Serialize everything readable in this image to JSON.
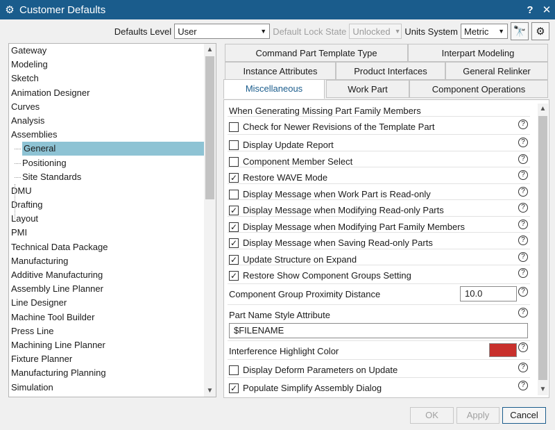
{
  "window": {
    "title": "Customer Defaults",
    "help_label": "?",
    "close_label": "✕",
    "gear_glyph": "⚙"
  },
  "toolbar": {
    "defaults_level_label": "Defaults Level",
    "defaults_level_value": "User",
    "lock_state_label": "Default Lock State",
    "lock_state_value": "Unlocked",
    "units_label": "Units System",
    "units_value": "Metric",
    "find_icon_glyph": "🔭",
    "settings_icon_glyph": "⚙"
  },
  "tree": {
    "items": [
      {
        "label": "Gateway"
      },
      {
        "label": "Modeling"
      },
      {
        "label": "Sketch"
      },
      {
        "label": "Animation Designer"
      },
      {
        "label": "Curves"
      },
      {
        "label": "Analysis"
      },
      {
        "label": "Assemblies"
      },
      {
        "label": "General"
      },
      {
        "label": "Positioning"
      },
      {
        "label": "Site Standards"
      },
      {
        "label": "DMU"
      },
      {
        "label": "Drafting"
      },
      {
        "label": "Layout"
      },
      {
        "label": "PMI"
      },
      {
        "label": "Technical Data Package"
      },
      {
        "label": "Manufacturing"
      },
      {
        "label": "Additive Manufacturing"
      },
      {
        "label": "Assembly Line Planner"
      },
      {
        "label": "Line Designer"
      },
      {
        "label": "Machine Tool Builder"
      },
      {
        "label": "Press Line"
      },
      {
        "label": "Machining Line Planner"
      },
      {
        "label": "Fixture Planner"
      },
      {
        "label": "Manufacturing Planning"
      },
      {
        "label": "Simulation"
      }
    ],
    "selected": "General"
  },
  "tabs": {
    "row1": [
      "Command Part Template Type",
      "Interpart Modeling"
    ],
    "row2": [
      "Instance Attributes",
      "Product Interfaces",
      "General Relinker"
    ],
    "row3": [
      "Miscellaneous",
      "Work Part",
      "Component Operations"
    ],
    "active": "Miscellaneous"
  },
  "panel": {
    "section_heading": "When Generating Missing Part Family Members",
    "options": [
      {
        "label": "Check for Newer Revisions of the Template Part",
        "checked": false
      },
      {
        "label": "Display Update Report",
        "checked": false
      },
      {
        "label": "Component Member Select",
        "checked": false
      },
      {
        "label": "Restore WAVE Mode",
        "checked": true
      },
      {
        "label": "Display Message when Work Part is Read-only",
        "checked": false
      },
      {
        "label": "Display Message when Modifying Read-only Parts",
        "checked": true
      },
      {
        "label": "Display Message when Modifying Part Family Members",
        "checked": true
      },
      {
        "label": "Display Message when Saving Read-only Parts",
        "checked": true
      },
      {
        "label": "Update Structure on Expand",
        "checked": true
      },
      {
        "label": "Restore Show Component Groups Setting",
        "checked": true
      }
    ],
    "proximity_label": "Component Group Proximity Distance",
    "proximity_value": "10.0",
    "part_name_label": "Part Name Style Attribute",
    "part_name_value": "$FILENAME",
    "interference_label": "Interference Highlight Color",
    "interference_color": "#c8302c",
    "extra_options": [
      {
        "label": "Display Deform Parameters on Update",
        "checked": false
      },
      {
        "label": "Populate Simplify Assembly Dialog",
        "checked": true
      }
    ],
    "help_glyph": "?",
    "check_glyph": "✓"
  },
  "buttons": {
    "ok": "OK",
    "apply": "Apply",
    "cancel": "Cancel"
  },
  "colors": {
    "titlebar": "#1a5c8c",
    "selection": "#8ec3d4",
    "highlight": "#fbf314"
  }
}
